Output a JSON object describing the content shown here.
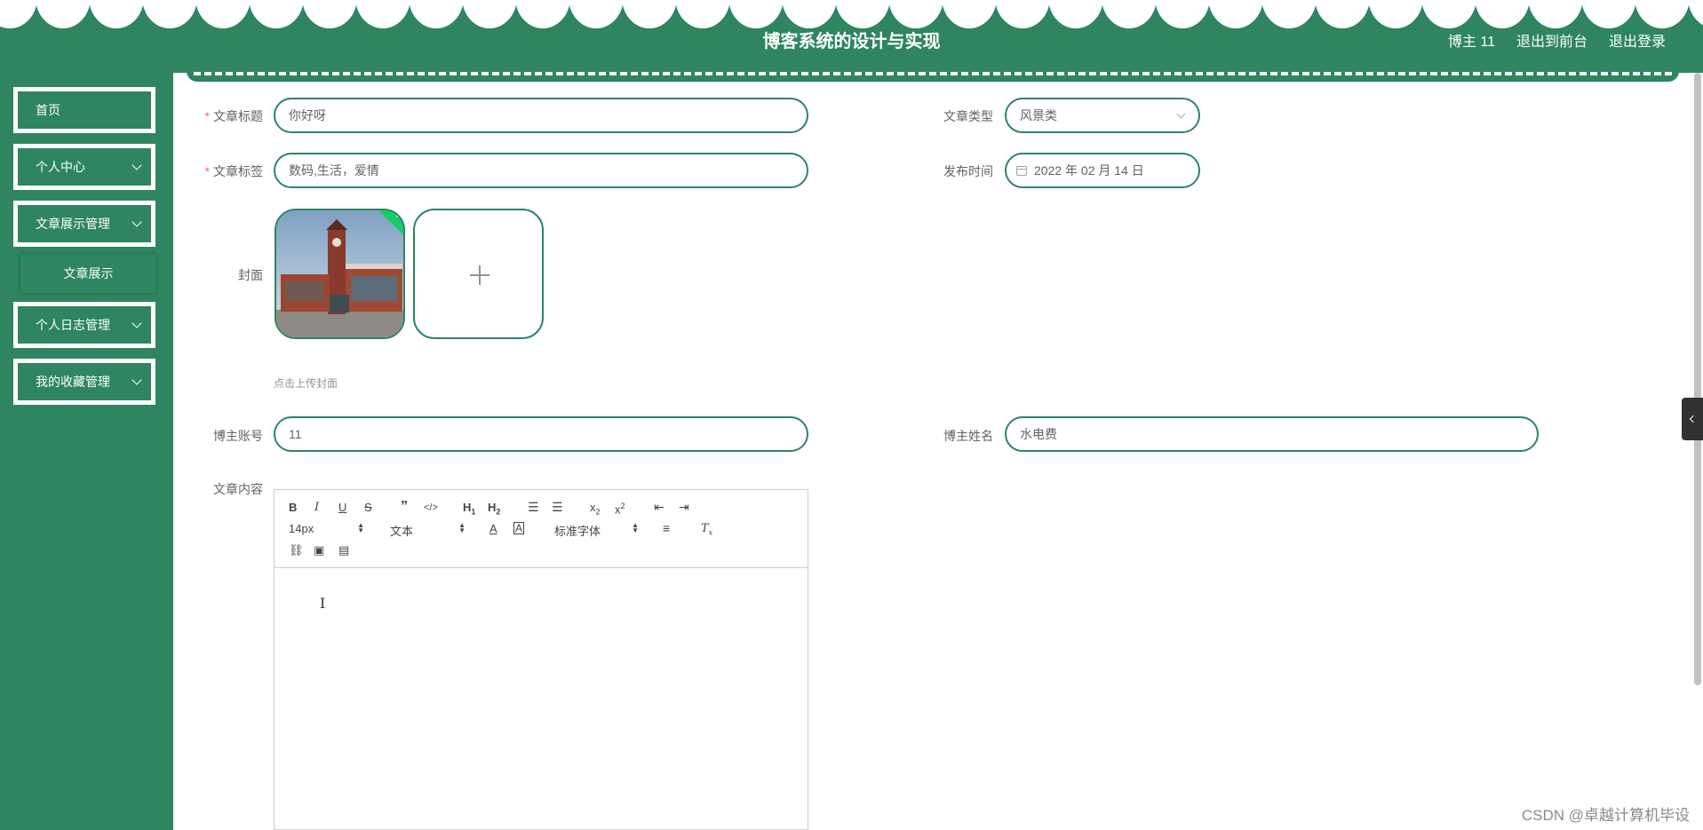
{
  "header": {
    "title": "博客系统的设计与实现",
    "user_label": "博主 11",
    "to_front_label": "退出到前台",
    "logout_label": "退出登录"
  },
  "sidebar": {
    "items": [
      {
        "label": "首页"
      },
      {
        "label": "个人中心"
      },
      {
        "label": "文章展示管理"
      },
      {
        "label": "文章展示"
      },
      {
        "label": "个人日志管理"
      },
      {
        "label": "我的收藏管理"
      }
    ]
  },
  "form": {
    "title": {
      "label": "文章标题",
      "value": "你好呀"
    },
    "type": {
      "label": "文章类型",
      "value": "风景类"
    },
    "tags": {
      "label": "文章标签",
      "value": "数码,生活，爱情"
    },
    "publish_time": {
      "label": "发布时间",
      "value": "2022 年 02 月 14 日"
    },
    "cover": {
      "label": "封面",
      "hint": "点击上传封面"
    },
    "account": {
      "label": "博主账号",
      "value": "11"
    },
    "name": {
      "label": "博主姓名",
      "value": "水电费"
    },
    "content": {
      "label": "文章内容"
    }
  },
  "editor": {
    "font_size": "14px",
    "header_select": "文本",
    "font_family": "标准字体"
  },
  "watermark": "CSDN @卓越计算机毕设",
  "colors": {
    "primary": "#2e8560",
    "required": "#f56c6c"
  }
}
